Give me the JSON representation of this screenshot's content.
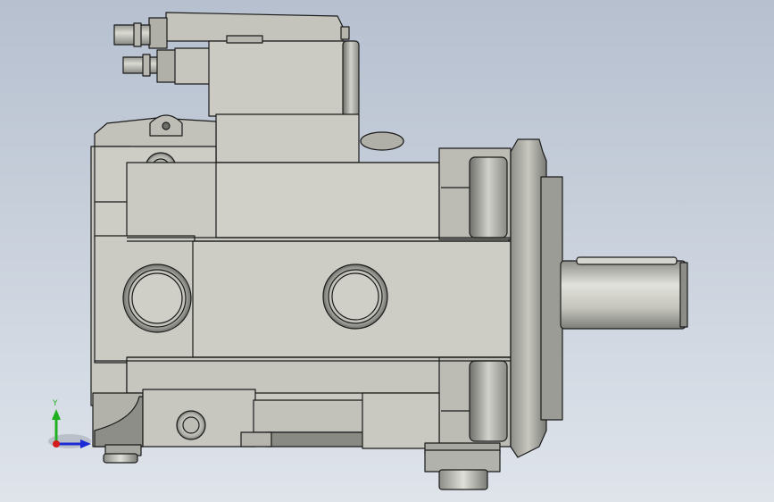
{
  "viewport": {
    "background_top": "#b8c2d0",
    "background_bottom": "#dde3ea",
    "model_color": "#c9c9c2",
    "edge_color": "#1a1a1a"
  },
  "triad": {
    "y_label": "Y",
    "y_color": "#1fb01f",
    "x_color": "#1d2bd6",
    "z_color": "#d41c1c"
  }
}
